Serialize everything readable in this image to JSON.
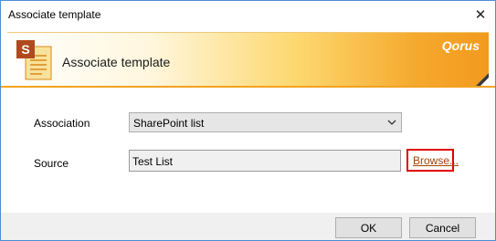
{
  "window": {
    "title": "Associate template",
    "close_glyph": "✕"
  },
  "banner": {
    "title": "Associate template",
    "brand": "Qorus",
    "icon": "sharepoint-document-icon",
    "colors": {
      "accent": "#f29a1f",
      "rule": "#f3a221"
    }
  },
  "form": {
    "association_label": "Association",
    "association_value": "SharePoint list",
    "source_label": "Source",
    "source_value": "Test List",
    "browse_label": "Browse..."
  },
  "buttons": {
    "ok": "OK",
    "cancel": "Cancel"
  },
  "colors": {
    "link": "#a54400",
    "highlight": "#e00000"
  }
}
